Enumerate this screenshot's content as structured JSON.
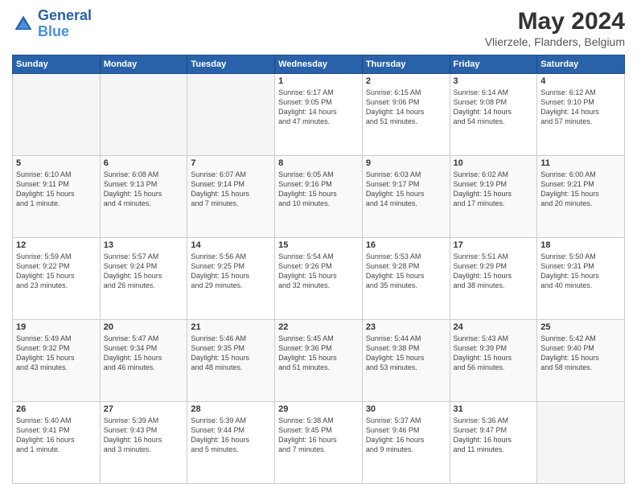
{
  "header": {
    "logo_general": "General",
    "logo_blue": "Blue",
    "title": "May 2024",
    "subtitle": "Vlierzele, Flanders, Belgium"
  },
  "columns": [
    "Sunday",
    "Monday",
    "Tuesday",
    "Wednesday",
    "Thursday",
    "Friday",
    "Saturday"
  ],
  "weeks": [
    [
      {
        "day": "",
        "info": ""
      },
      {
        "day": "",
        "info": ""
      },
      {
        "day": "",
        "info": ""
      },
      {
        "day": "1",
        "info": "Sunrise: 6:17 AM\nSunset: 9:05 PM\nDaylight: 14 hours\nand 47 minutes."
      },
      {
        "day": "2",
        "info": "Sunrise: 6:15 AM\nSunset: 9:06 PM\nDaylight: 14 hours\nand 51 minutes."
      },
      {
        "day": "3",
        "info": "Sunrise: 6:14 AM\nSunset: 9:08 PM\nDaylight: 14 hours\nand 54 minutes."
      },
      {
        "day": "4",
        "info": "Sunrise: 6:12 AM\nSunset: 9:10 PM\nDaylight: 14 hours\nand 57 minutes."
      }
    ],
    [
      {
        "day": "5",
        "info": "Sunrise: 6:10 AM\nSunset: 9:11 PM\nDaylight: 15 hours\nand 1 minute."
      },
      {
        "day": "6",
        "info": "Sunrise: 6:08 AM\nSunset: 9:13 PM\nDaylight: 15 hours\nand 4 minutes."
      },
      {
        "day": "7",
        "info": "Sunrise: 6:07 AM\nSunset: 9:14 PM\nDaylight: 15 hours\nand 7 minutes."
      },
      {
        "day": "8",
        "info": "Sunrise: 6:05 AM\nSunset: 9:16 PM\nDaylight: 15 hours\nand 10 minutes."
      },
      {
        "day": "9",
        "info": "Sunrise: 6:03 AM\nSunset: 9:17 PM\nDaylight: 15 hours\nand 14 minutes."
      },
      {
        "day": "10",
        "info": "Sunrise: 6:02 AM\nSunset: 9:19 PM\nDaylight: 15 hours\nand 17 minutes."
      },
      {
        "day": "11",
        "info": "Sunrise: 6:00 AM\nSunset: 9:21 PM\nDaylight: 15 hours\nand 20 minutes."
      }
    ],
    [
      {
        "day": "12",
        "info": "Sunrise: 5:59 AM\nSunset: 9:22 PM\nDaylight: 15 hours\nand 23 minutes."
      },
      {
        "day": "13",
        "info": "Sunrise: 5:57 AM\nSunset: 9:24 PM\nDaylight: 15 hours\nand 26 minutes."
      },
      {
        "day": "14",
        "info": "Sunrise: 5:56 AM\nSunset: 9:25 PM\nDaylight: 15 hours\nand 29 minutes."
      },
      {
        "day": "15",
        "info": "Sunrise: 5:54 AM\nSunset: 9:26 PM\nDaylight: 15 hours\nand 32 minutes."
      },
      {
        "day": "16",
        "info": "Sunrise: 5:53 AM\nSunset: 9:28 PM\nDaylight: 15 hours\nand 35 minutes."
      },
      {
        "day": "17",
        "info": "Sunrise: 5:51 AM\nSunset: 9:29 PM\nDaylight: 15 hours\nand 38 minutes."
      },
      {
        "day": "18",
        "info": "Sunrise: 5:50 AM\nSunset: 9:31 PM\nDaylight: 15 hours\nand 40 minutes."
      }
    ],
    [
      {
        "day": "19",
        "info": "Sunrise: 5:49 AM\nSunset: 9:32 PM\nDaylight: 15 hours\nand 43 minutes."
      },
      {
        "day": "20",
        "info": "Sunrise: 5:47 AM\nSunset: 9:34 PM\nDaylight: 15 hours\nand 46 minutes."
      },
      {
        "day": "21",
        "info": "Sunrise: 5:46 AM\nSunset: 9:35 PM\nDaylight: 15 hours\nand 48 minutes."
      },
      {
        "day": "22",
        "info": "Sunrise: 5:45 AM\nSunset: 9:36 PM\nDaylight: 15 hours\nand 51 minutes."
      },
      {
        "day": "23",
        "info": "Sunrise: 5:44 AM\nSunset: 9:38 PM\nDaylight: 15 hours\nand 53 minutes."
      },
      {
        "day": "24",
        "info": "Sunrise: 5:43 AM\nSunset: 9:39 PM\nDaylight: 15 hours\nand 56 minutes."
      },
      {
        "day": "25",
        "info": "Sunrise: 5:42 AM\nSunset: 9:40 PM\nDaylight: 15 hours\nand 58 minutes."
      }
    ],
    [
      {
        "day": "26",
        "info": "Sunrise: 5:40 AM\nSunset: 9:41 PM\nDaylight: 16 hours\nand 1 minute."
      },
      {
        "day": "27",
        "info": "Sunrise: 5:39 AM\nSunset: 9:43 PM\nDaylight: 16 hours\nand 3 minutes."
      },
      {
        "day": "28",
        "info": "Sunrise: 5:39 AM\nSunset: 9:44 PM\nDaylight: 16 hours\nand 5 minutes."
      },
      {
        "day": "29",
        "info": "Sunrise: 5:38 AM\nSunset: 9:45 PM\nDaylight: 16 hours\nand 7 minutes."
      },
      {
        "day": "30",
        "info": "Sunrise: 5:37 AM\nSunset: 9:46 PM\nDaylight: 16 hours\nand 9 minutes."
      },
      {
        "day": "31",
        "info": "Sunrise: 5:36 AM\nSunset: 9:47 PM\nDaylight: 16 hours\nand 11 minutes."
      },
      {
        "day": "",
        "info": ""
      }
    ]
  ]
}
